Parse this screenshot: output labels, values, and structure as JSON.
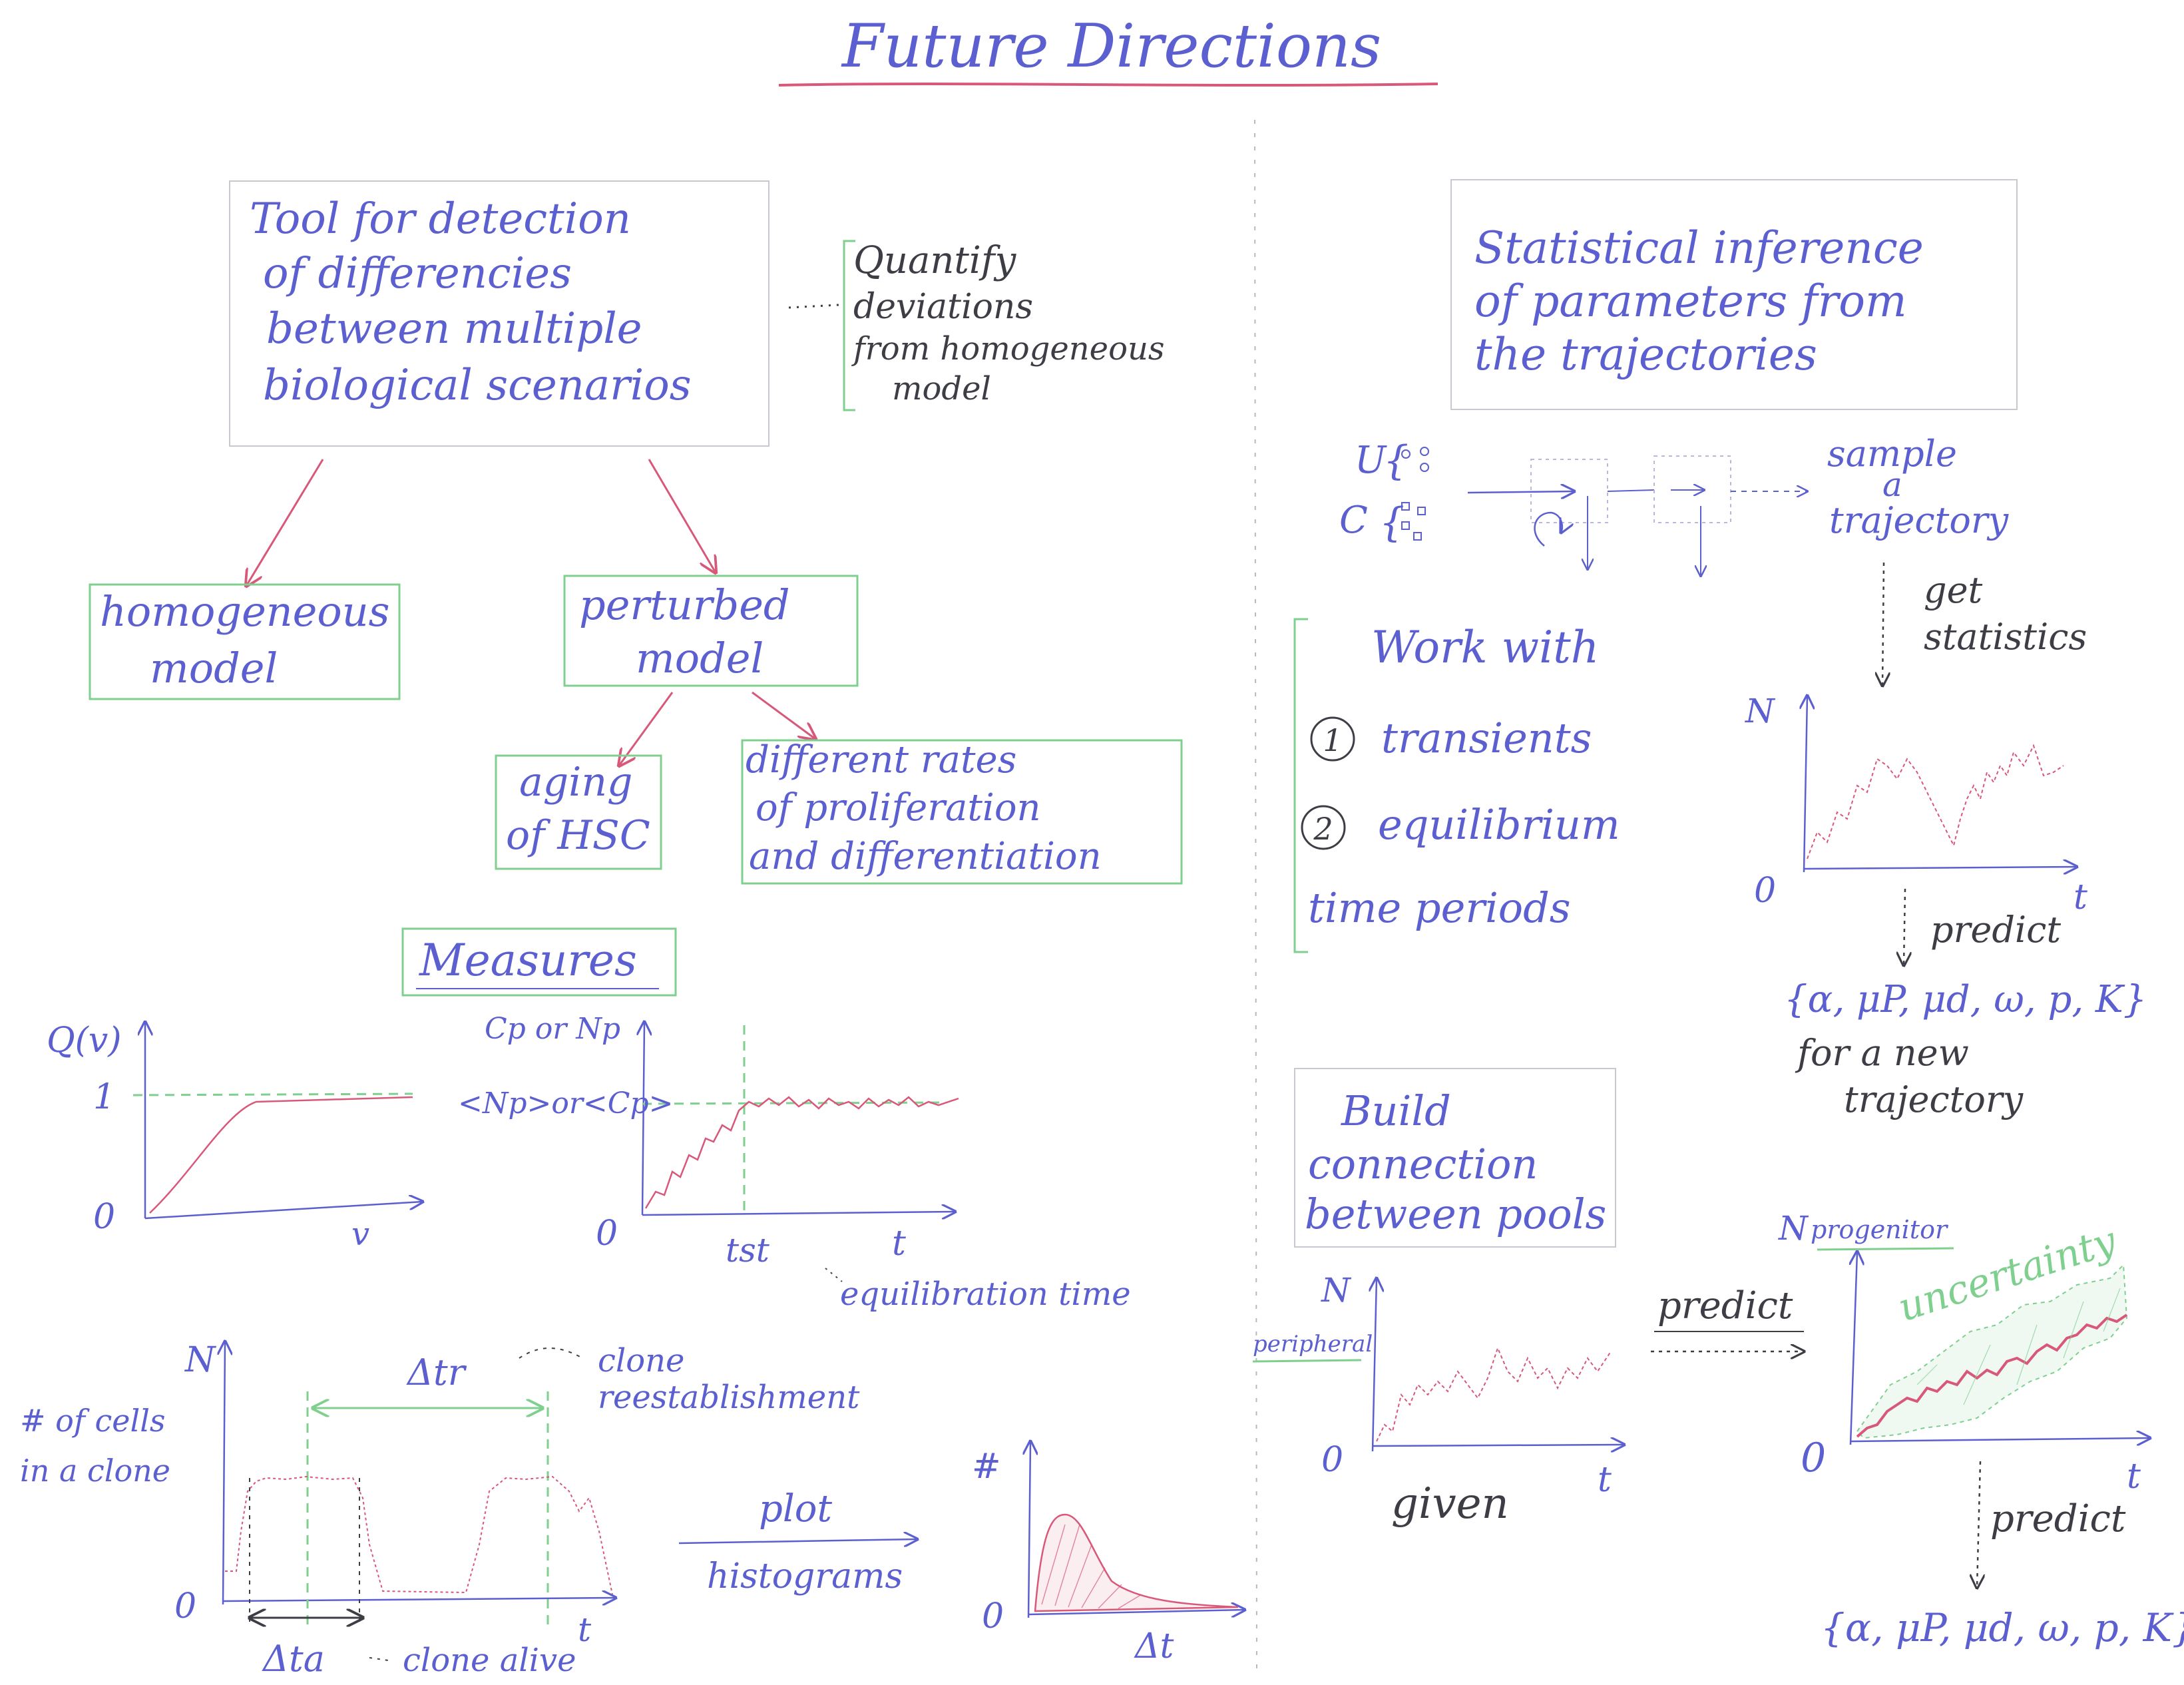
{
  "title": "Future Directions",
  "tool_box": {
    "lines": [
      "Tool for detection",
      "of differencies",
      "between multiple",
      "biological scenarios"
    ]
  },
  "quantify_note": {
    "lines": [
      "Quantify",
      "deviations",
      "from homogeneous",
      "model"
    ]
  },
  "homogeneous_box": {
    "lines": [
      "homogeneous",
      "model"
    ]
  },
  "perturbed_box": {
    "lines": [
      "perturbed",
      "model"
    ]
  },
  "aging_box": {
    "lines": [
      "aging",
      "of HSC"
    ]
  },
  "rates_box": {
    "lines": [
      "different rates",
      "of proliferation",
      "and differentiation"
    ]
  },
  "measures_title": "Measures",
  "q_plot": {
    "ylabel": "Q(v)",
    "xlabel": "v",
    "tick_one": "1",
    "origin": "0"
  },
  "eq_plot": {
    "ylabel": "Cp or Np",
    "level_label": "<Np>or<Cp>",
    "xlabel": "t",
    "tst_label": "tst",
    "tst_note": "equilibration time",
    "origin": "0"
  },
  "clone_plot": {
    "ylabel": "N",
    "side_label_1": "# of cells",
    "side_label_2": "in a clone",
    "delta_r": "Δtr",
    "delta_r_note_1": "clone",
    "delta_r_note_2": "reestablishment",
    "delta_a": "Δta",
    "delta_a_note": "clone alive",
    "xlabel": "t",
    "origin": "0"
  },
  "plot_arrow": {
    "above": "plot",
    "below": "histograms"
  },
  "hist_plot": {
    "ylabel": "#",
    "xlabel": "Δt",
    "origin": "0"
  },
  "stat_box": {
    "lines": [
      "Statistical inference",
      "of parameters from",
      "the trajectories"
    ]
  },
  "schematic": {
    "u_label": "U",
    "c_label": "C",
    "sample_lines": [
      "sample",
      "a",
      "trajectory"
    ],
    "get_lines": [
      "get",
      "statistics"
    ]
  },
  "work_box": {
    "title": "Work with",
    "item1_num": "1",
    "item1": "transients",
    "item2_num": "2",
    "item2": "equilibrium",
    "footer": "time periods"
  },
  "stat_plot": {
    "ylabel": "N",
    "xlabel": "t",
    "origin": "0"
  },
  "predict_1": {
    "label": "predict",
    "params": "{α, μP, μd, ω, p, K}",
    "note_1": "for a new",
    "note_2": "trajectory"
  },
  "build_box": {
    "lines": [
      "Build",
      "connection",
      "between pools"
    ]
  },
  "periph_plot": {
    "ylabel": "N",
    "ysub": "peripheral",
    "xlabel": "t",
    "origin": "0",
    "given": "given"
  },
  "predict_2": {
    "label": "predict"
  },
  "prog_plot": {
    "ylabel": "N",
    "ysub": "progenitor",
    "xlabel": "t",
    "origin": "0",
    "uncertainty": "uncertainty"
  },
  "predict_3": {
    "label": "predict",
    "params": "{α, μP, μd, ω, p, K}"
  },
  "colors": {
    "ink_blue": "#5b5fcf",
    "ink_dark": "#3d3d45",
    "ink_red": "#d8587a",
    "ink_green": "#7fcf8f"
  }
}
